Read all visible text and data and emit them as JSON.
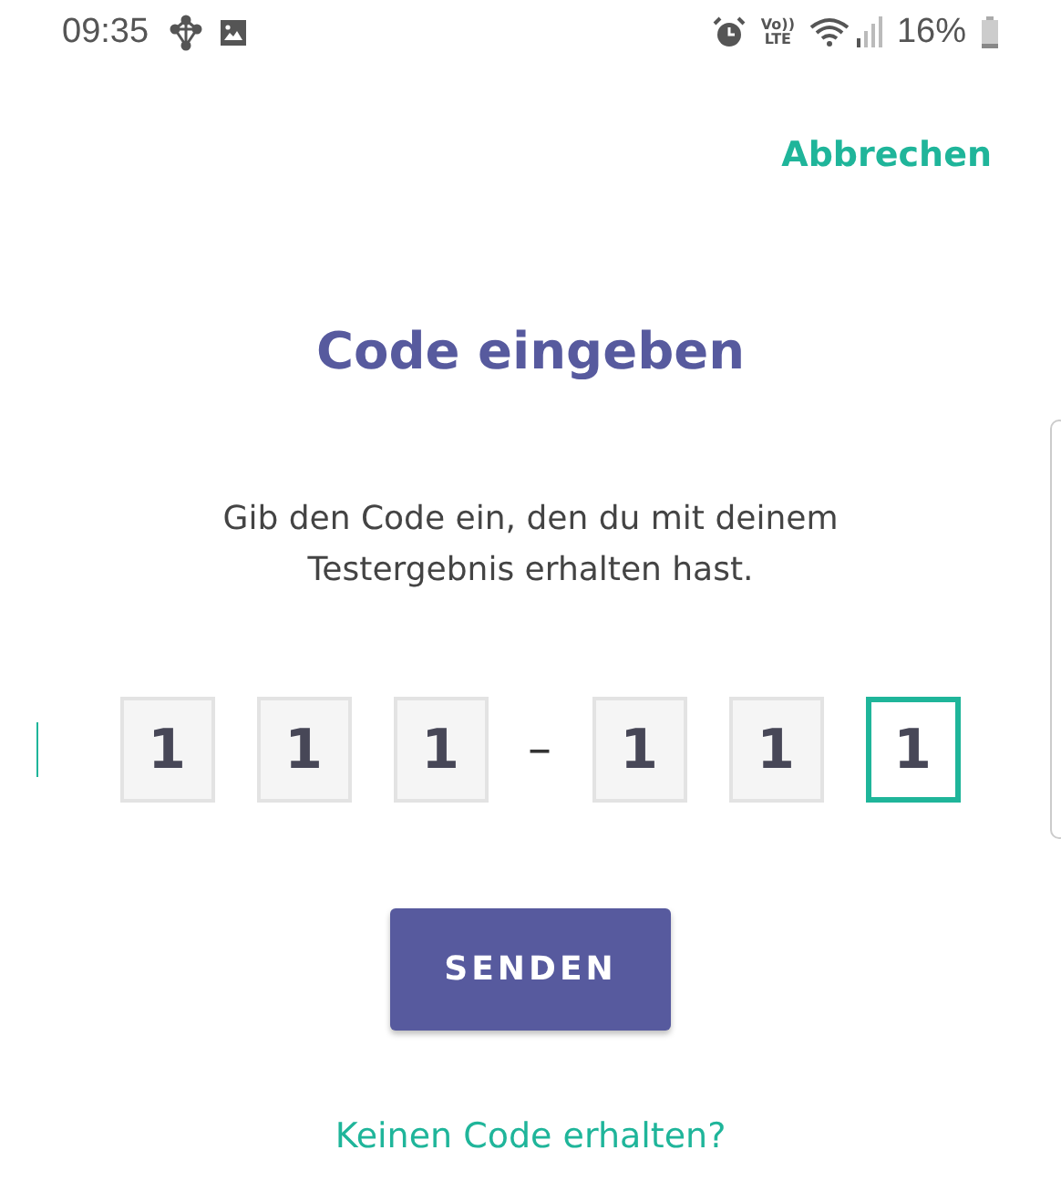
{
  "status_bar": {
    "time": "09:35",
    "network": "Vo))\nLTE",
    "battery": "16%"
  },
  "cancel": "Abbrechen",
  "title": "Code eingeben",
  "description": "Gib den Code ein, den du mit deinem Testergebnis erhalten hast.",
  "code_groups": [
    [
      {
        "value": "1",
        "selected": false
      },
      {
        "value": "1",
        "selected": false
      },
      {
        "value": "1",
        "selected": false
      }
    ],
    [
      {
        "value": "1",
        "selected": false
      },
      {
        "value": "1",
        "selected": false
      },
      {
        "value": "1",
        "selected": true
      }
    ]
  ],
  "separator": "–",
  "submit": "SENDEN",
  "help_link": "Keinen Code erhalten?"
}
